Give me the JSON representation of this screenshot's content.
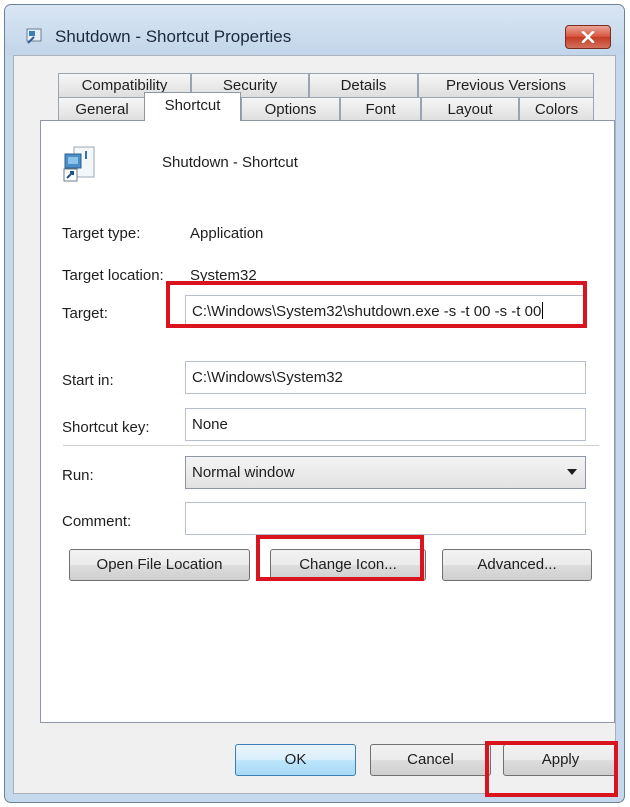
{
  "window": {
    "title": "Shutdown - Shortcut Properties"
  },
  "tabs": {
    "row1": [
      "Compatibility",
      "Security",
      "Details",
      "Previous Versions"
    ],
    "row2": [
      "General",
      "Shortcut",
      "Options",
      "Font",
      "Layout",
      "Colors"
    ],
    "selected": "Shortcut"
  },
  "shortcut": {
    "name": "Shutdown - Shortcut",
    "target_type_label": "Target type:",
    "target_type_value": "Application",
    "target_location_label": "Target location:",
    "target_location_value": "System32",
    "target_label": "Target:",
    "target_value": "C:\\Windows\\System32\\shutdown.exe -s -t 00 -s -t 00",
    "start_in_label": "Start in:",
    "start_in_value": "C:\\Windows\\System32",
    "shortcut_key_label": "Shortcut key:",
    "shortcut_key_value": "None",
    "run_label": "Run:",
    "run_value": "Normal window",
    "comment_label": "Comment:",
    "comment_value": ""
  },
  "buttons": {
    "open_file_location": "Open File Location",
    "change_icon": "Change Icon...",
    "advanced": "Advanced...",
    "ok": "OK",
    "cancel": "Cancel",
    "apply": "Apply"
  },
  "colors": {
    "highlight": "#d9141e",
    "close_button": "#c33b24",
    "frame": "#c6d8ec"
  }
}
